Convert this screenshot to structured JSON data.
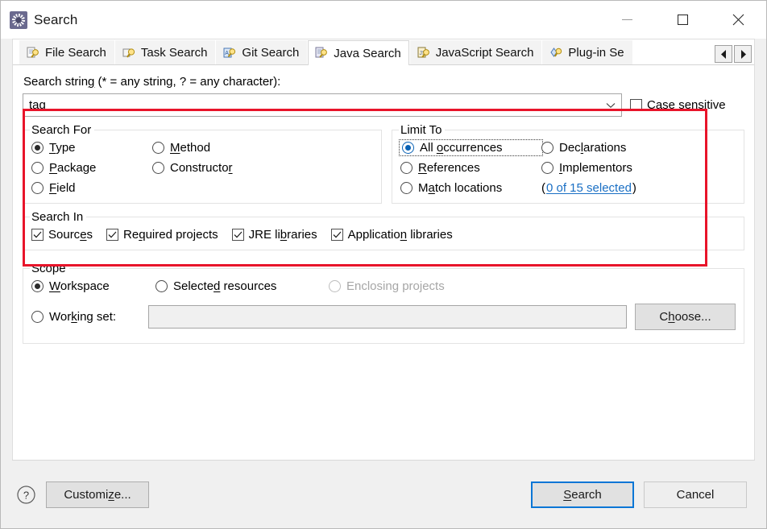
{
  "window": {
    "title": "Search",
    "icon": "search-app-icon",
    "minimize_label": "Minimize",
    "maximize_label": "Maximize",
    "close_label": "Close"
  },
  "tabs": {
    "items": [
      {
        "label": "File Search",
        "icon": "file-search-icon",
        "selected": false
      },
      {
        "label": "Task Search",
        "icon": "task-search-icon",
        "selected": false
      },
      {
        "label": "Git Search",
        "icon": "git-search-icon",
        "selected": false
      },
      {
        "label": "Java Search",
        "icon": "java-search-icon",
        "selected": true
      },
      {
        "label": "JavaScript Search",
        "icon": "javascript-search-icon",
        "selected": false
      },
      {
        "label": "Plug-in Se",
        "icon": "plugin-search-icon",
        "selected": false
      }
    ],
    "scroll_left": "◀",
    "scroll_right": "▶"
  },
  "search_string": {
    "label": "Search string (* = any string, ? = any character):",
    "value": "tag",
    "placeholder": "",
    "dropdown_icon": "chevron-down-icon",
    "case_sensitive_label": "Case sensitive",
    "case_sensitive_checked": false
  },
  "search_for": {
    "legend": "Search For",
    "options": [
      {
        "label": "Type",
        "selected": true
      },
      {
        "label": "Method",
        "selected": false
      },
      {
        "label": "Package",
        "selected": false
      },
      {
        "label": "Constructor",
        "selected": false
      },
      {
        "label": "Field",
        "selected": false
      }
    ]
  },
  "limit_to": {
    "legend": "Limit To",
    "options": [
      {
        "label": "All occurrences",
        "selected": true,
        "focused": true
      },
      {
        "label": "Declarations",
        "selected": false,
        "focused": false
      },
      {
        "label": "References",
        "selected": false,
        "focused": false
      },
      {
        "label": "Implementors",
        "selected": false,
        "focused": false
      },
      {
        "label": "Match locations",
        "selected": false,
        "focused": false
      }
    ],
    "match_locations_link": "0 of 15 selected",
    "match_locations_paren_open": "(",
    "match_locations_paren_close": ")"
  },
  "search_in": {
    "legend": "Search In",
    "options": [
      {
        "label": "Sources",
        "checked": true
      },
      {
        "label": "Required projects",
        "checked": true
      },
      {
        "label": "JRE libraries",
        "checked": true
      },
      {
        "label": "Application libraries",
        "checked": true
      }
    ]
  },
  "scope": {
    "legend": "Scope",
    "options": [
      {
        "label": "Workspace",
        "selected": true,
        "disabled": false
      },
      {
        "label": "Selected resources",
        "selected": false,
        "disabled": false
      },
      {
        "label": "Enclosing projects",
        "selected": false,
        "disabled": true
      },
      {
        "label": "Working set:",
        "selected": false,
        "disabled": false
      }
    ],
    "working_set_value": "",
    "choose_label": "Choose..."
  },
  "footer": {
    "help_icon": "help-icon",
    "customize_label": "Customize...",
    "search_label": "Search",
    "cancel_label": "Cancel"
  },
  "highlight": {
    "color": "#e8142a"
  }
}
